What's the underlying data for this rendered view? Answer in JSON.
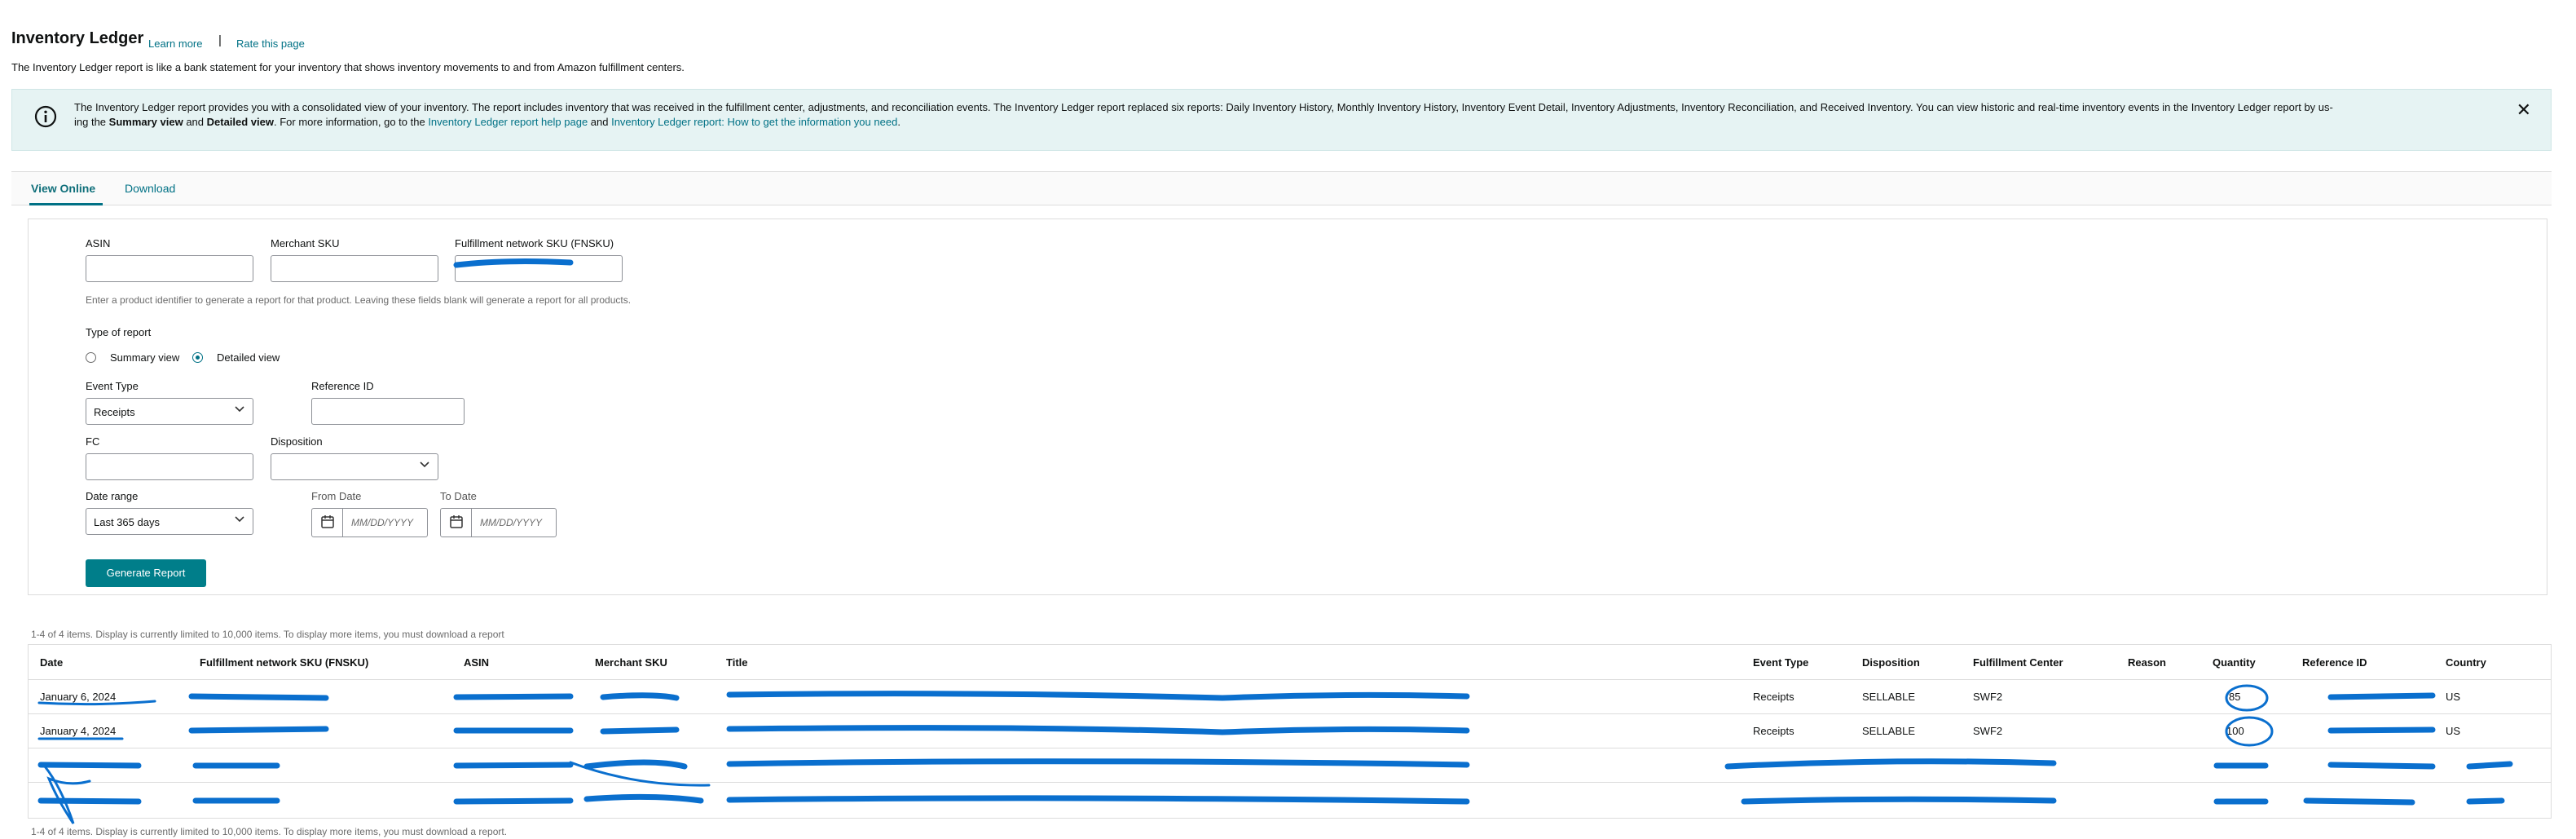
{
  "header": {
    "title": "Inventory Ledger",
    "learn_more": "Learn more",
    "separator": "|",
    "rate_page": "Rate this page",
    "subtitle": "The Inventory Ledger report is like a bank statement for your inventory that shows inventory movements to and from Amazon fulfillment centers."
  },
  "banner": {
    "line1": "The Inventory Ledger report provides you with a consolidated view of your inventory. The report includes inventory that was received in the fulfillment center, adjustments, and reconciliation events. The Inventory Ledger report replaced six reports: Daily Inventory History, Monthly Inventory History, Inventory Event Detail, Inventory Adjustments, Inventory Reconciliation, and Received Inventory. You can view historic and real-time inventory events in the Inventory Ledger report by us-",
    "line2_prefix": "ing the ",
    "summary_bold": "Summary view",
    "and_text": " and ",
    "detailed_bold": "Detailed view",
    "line2_mid": ". For more information, go to the ",
    "help_link": "Inventory Ledger report help page",
    "and_text2": " and ",
    "howto_link": "Inventory Ledger report: How to get the information you need",
    "period": ".",
    "close_icon": "close-icon",
    "info_icon": "info-icon"
  },
  "tabs": [
    {
      "label": "View Online",
      "active": true
    },
    {
      "label": "Download",
      "active": false
    }
  ],
  "form": {
    "asin_label": "ASIN",
    "msku_label": "Merchant SKU",
    "fnsku_label": "Fulfillment network SKU (FNSKU)",
    "asin_value": "",
    "msku_value": "",
    "fnsku_value": "",
    "identifier_hint": "Enter a product identifier to generate a report for that product. Leaving these fields blank will generate a report for all products.",
    "report_type_label": "Type of report",
    "summary_view_label": "Summary view",
    "detailed_view_label": "Detailed view",
    "selected_view": "Detailed view",
    "event_type_label": "Event Type",
    "event_type_value": "Receipts",
    "reference_id_label": "Reference ID",
    "reference_id_value": "",
    "fc_label": "FC",
    "fc_value": "",
    "disposition_label": "Disposition",
    "disposition_value": "",
    "date_range_label": "Date range",
    "date_range_value": "Last 365 days",
    "from_date_label": "From Date",
    "to_date_label": "To Date",
    "date_placeholder": "MM/DD/YYYY",
    "generate_button": "Generate Report"
  },
  "results": {
    "count_text": "1-4 of 4 items. Display is currently limited to 10,000 items. To display more items, you must download a report",
    "footer_count_text": "1-4 of 4 items. Display is currently limited to 10,000 items. To display more items, you must download a report.",
    "columns": [
      "Date",
      "Fulfillment network SKU (FNSKU)",
      "ASIN",
      "Merchant SKU",
      "Title",
      "Event Type",
      "Disposition",
      "Fulfillment Center",
      "Reason",
      "Quantity",
      "Reference ID",
      "Country"
    ],
    "rows": [
      {
        "date": "January 6, 2024",
        "event_type": "Receipts",
        "disposition": "SELLABLE",
        "fc": "SWF2",
        "reason": "",
        "quantity": "85",
        "country": "US"
      },
      {
        "date": "January 4, 2024",
        "event_type": "Receipts",
        "disposition": "SELLABLE",
        "fc": "SWF2",
        "reason": "",
        "quantity": "100",
        "country": "US"
      },
      {
        "date": "",
        "event_type": "",
        "disposition": "",
        "fc": "",
        "reason": "",
        "quantity": "",
        "country": ""
      },
      {
        "date": "",
        "event_type": "",
        "disposition": "",
        "fc": "",
        "reason": "",
        "quantity": "",
        "country": ""
      }
    ]
  },
  "colors": {
    "accent": "#007185",
    "button": "#007e8a",
    "banner_bg": "#e6f3f3",
    "redaction": "#0a6fce"
  }
}
